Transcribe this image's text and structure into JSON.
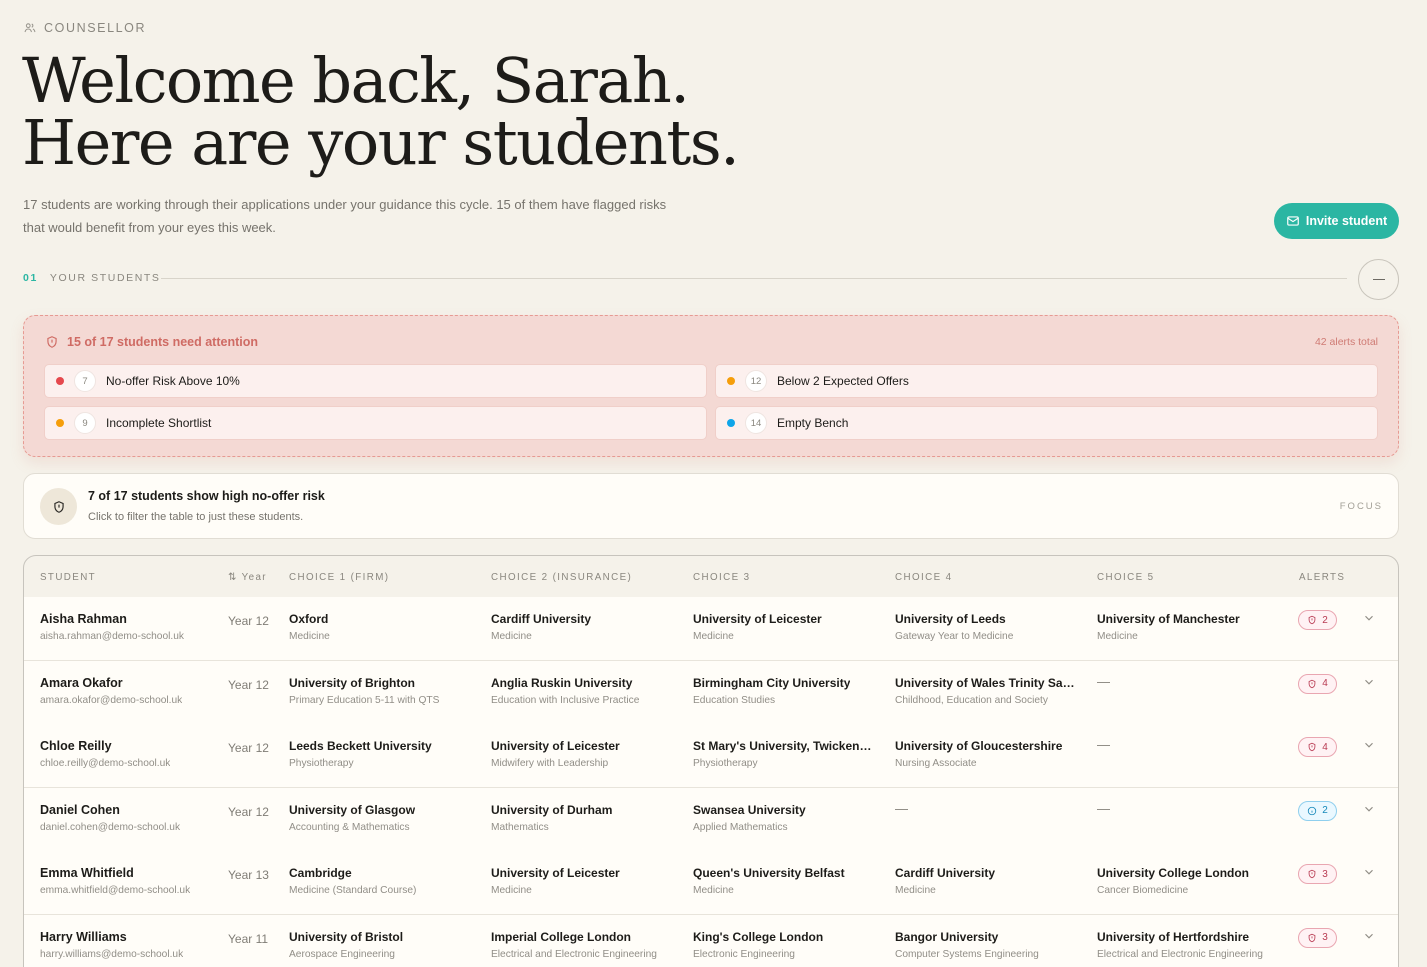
{
  "role_label": "COUNSELLOR",
  "hero": {
    "line1": "Welcome back, Sarah.",
    "line2": "Here are your students."
  },
  "intro": {
    "line1": "17 students are working through their applications under your guidance this cycle. 15 of them have flagged risks",
    "line2": "that would benefit from your eyes this week."
  },
  "invite_label": "Invite student",
  "section": {
    "number": "01",
    "title": "YOUR STUDENTS"
  },
  "alerts": {
    "title": "15 of 17 students need attention",
    "total": "42 alerts total",
    "items": [
      {
        "count": "7",
        "label": "No-offer Risk Above 10%",
        "color": "#e5484d"
      },
      {
        "count": "12",
        "label": "Below 2 Expected Offers",
        "color": "#f59e0b"
      },
      {
        "count": "9",
        "label": "Incomplete Shortlist",
        "color": "#f59e0b"
      },
      {
        "count": "14",
        "label": "Empty Bench",
        "color": "#0ea5e9"
      }
    ]
  },
  "focus": {
    "title": "7 of 17 students show high no-offer risk",
    "subtitle": "Click to filter the table to just these students.",
    "tag": "FOCUS"
  },
  "table": {
    "headers": {
      "student": "STUDENT",
      "year": "Year",
      "choice1": "CHOICE 1 (FIRM)",
      "choice2": "CHOICE 2 (INSURANCE)",
      "choice3": "CHOICE 3",
      "choice4": "CHOICE 4",
      "choice5": "CHOICE 5",
      "alerts": "ALERTS"
    },
    "empty_value": "—",
    "rows": [
      {
        "name": "Aisha Rahman",
        "email": "aisha.rahman@demo-school.uk",
        "year": "Year 12",
        "choices": [
          {
            "uni": "Oxford",
            "course": "Medicine"
          },
          {
            "uni": "Cardiff University",
            "course": "Medicine"
          },
          {
            "uni": "University of Leicester",
            "course": "Medicine"
          },
          {
            "uni": "University of Leeds",
            "course": "Gateway Year to Medicine"
          },
          {
            "uni": "University of Manchester",
            "course": "Medicine"
          }
        ],
        "alerts": "2",
        "alert_type": "risk"
      },
      {
        "name": "Amara Okafor",
        "email": "amara.okafor@demo-school.uk",
        "year": "Year 12",
        "choices": [
          {
            "uni": "University of Brighton",
            "course": "Primary Education 5-11 with QTS"
          },
          {
            "uni": "Anglia Ruskin University",
            "course": "Education with Inclusive Practice"
          },
          {
            "uni": "Birmingham City University",
            "course": "Education Studies"
          },
          {
            "uni": "University of Wales Trinity Sain...",
            "course": "Childhood, Education and Society"
          },
          null
        ],
        "alerts": "4",
        "alert_type": "risk"
      },
      {
        "name": "Chloe Reilly",
        "email": "chloe.reilly@demo-school.uk",
        "year": "Year 12",
        "choices": [
          {
            "uni": "Leeds Beckett University",
            "course": "Physiotherapy"
          },
          {
            "uni": "University of Leicester",
            "course": "Midwifery with Leadership"
          },
          {
            "uni": "St Mary's University, Twickenha...",
            "course": "Physiotherapy"
          },
          {
            "uni": "University of Gloucestershire",
            "course": "Nursing Associate"
          },
          null
        ],
        "alerts": "4",
        "alert_type": "risk"
      },
      {
        "name": "Daniel Cohen",
        "email": "daniel.cohen@demo-school.uk",
        "year": "Year 12",
        "choices": [
          {
            "uni": "University of Glasgow",
            "course": "Accounting & Mathematics"
          },
          {
            "uni": "University of Durham",
            "course": "Mathematics"
          },
          {
            "uni": "Swansea University",
            "course": "Applied Mathematics"
          },
          null,
          null
        ],
        "alerts": "2",
        "alert_type": "info"
      },
      {
        "name": "Emma Whitfield",
        "email": "emma.whitfield@demo-school.uk",
        "year": "Year 13",
        "choices": [
          {
            "uni": "Cambridge",
            "course": "Medicine (Standard Course)"
          },
          {
            "uni": "University of Leicester",
            "course": "Medicine"
          },
          {
            "uni": "Queen's University Belfast",
            "course": "Medicine"
          },
          {
            "uni": "Cardiff University",
            "course": "Medicine"
          },
          {
            "uni": "University College London",
            "course": "Cancer Biomedicine"
          }
        ],
        "alerts": "3",
        "alert_type": "risk"
      },
      {
        "name": "Harry Williams",
        "email": "harry.williams@demo-school.uk",
        "year": "Year 11",
        "choices": [
          {
            "uni": "University of Bristol",
            "course": "Aerospace Engineering"
          },
          {
            "uni": "Imperial College London",
            "course": "Electrical and Electronic Engineering"
          },
          {
            "uni": "King's College London",
            "course": "Electronic Engineering"
          },
          {
            "uni": "Bangor University",
            "course": "Computer Systems Engineering"
          },
          {
            "uni": "University of Hertfordshire",
            "course": "Electrical and Electronic Engineering"
          }
        ],
        "alerts": "3",
        "alert_type": "risk"
      }
    ]
  }
}
